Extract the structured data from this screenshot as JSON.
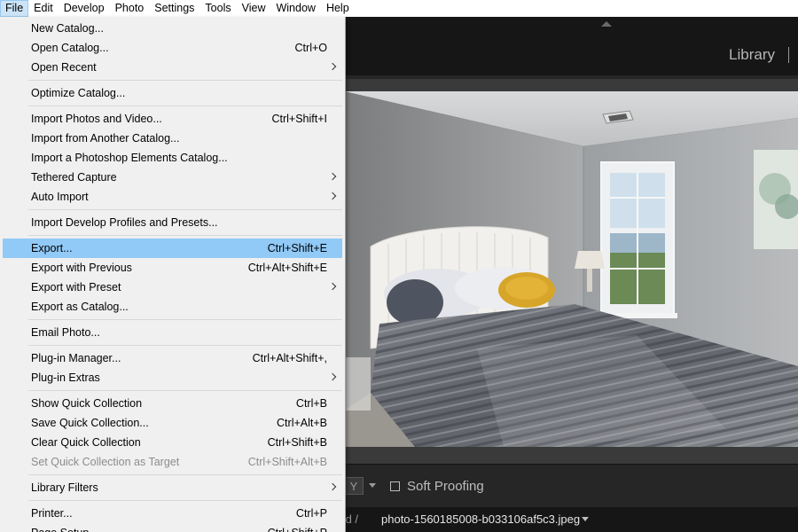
{
  "menubar": {
    "items": [
      {
        "label": "File"
      },
      {
        "label": "Edit"
      },
      {
        "label": "Develop"
      },
      {
        "label": "Photo"
      },
      {
        "label": "Settings"
      },
      {
        "label": "Tools"
      },
      {
        "label": "View"
      },
      {
        "label": "Window"
      },
      {
        "label": "Help"
      }
    ],
    "active": "File"
  },
  "module": {
    "name": "Library"
  },
  "toolbar": {
    "yy_label": "Y",
    "soft_proofing_label": "Soft Proofing"
  },
  "filmstrip": {
    "selected_text": "ected /",
    "filename": "photo-1560185008-b033106af5c3.jpeg"
  },
  "file_menu": {
    "items": [
      {
        "label": "New Catalog...",
        "shortcut": "",
        "submenu": false
      },
      {
        "label": "Open Catalog...",
        "shortcut": "Ctrl+O",
        "submenu": false
      },
      {
        "label": "Open Recent",
        "shortcut": "",
        "submenu": true
      },
      {
        "label": "Optimize Catalog...",
        "shortcut": "",
        "submenu": false
      },
      {
        "label": "Import Photos and Video...",
        "shortcut": "Ctrl+Shift+I",
        "submenu": false
      },
      {
        "label": "Import from Another Catalog...",
        "shortcut": "",
        "submenu": false
      },
      {
        "label": "Import a Photoshop Elements Catalog...",
        "shortcut": "",
        "submenu": false
      },
      {
        "label": "Tethered Capture",
        "shortcut": "",
        "submenu": true
      },
      {
        "label": "Auto Import",
        "shortcut": "",
        "submenu": true
      },
      {
        "label": "Import Develop Profiles and Presets...",
        "shortcut": "",
        "submenu": false
      },
      {
        "label": "Export...",
        "shortcut": "Ctrl+Shift+E",
        "submenu": false,
        "highlighted": true
      },
      {
        "label": "Export with Previous",
        "shortcut": "Ctrl+Alt+Shift+E",
        "submenu": false
      },
      {
        "label": "Export with Preset",
        "shortcut": "",
        "submenu": true
      },
      {
        "label": "Export as Catalog...",
        "shortcut": "",
        "submenu": false
      },
      {
        "label": "Email Photo...",
        "shortcut": "",
        "submenu": false
      },
      {
        "label": "Plug-in Manager...",
        "shortcut": "Ctrl+Alt+Shift+,",
        "submenu": false
      },
      {
        "label": "Plug-in Extras",
        "shortcut": "",
        "submenu": true
      },
      {
        "label": "Show Quick Collection",
        "shortcut": "Ctrl+B",
        "submenu": false
      },
      {
        "label": "Save Quick Collection...",
        "shortcut": "Ctrl+Alt+B",
        "submenu": false
      },
      {
        "label": "Clear Quick Collection",
        "shortcut": "Ctrl+Shift+B",
        "submenu": false
      },
      {
        "label": "Set Quick Collection as Target",
        "shortcut": "Ctrl+Shift+Alt+B",
        "submenu": false,
        "disabled": true
      },
      {
        "label": "Library Filters",
        "shortcut": "",
        "submenu": true
      },
      {
        "label": "Printer...",
        "shortcut": "Ctrl+P",
        "submenu": false
      },
      {
        "label": "Page Setup...",
        "shortcut": "Ctrl+Shift+P",
        "submenu": false
      }
    ]
  },
  "colors": {
    "highlight": "#91c9f7",
    "menu_bg": "#f0f0f0",
    "app_bg": "#1e1e1e"
  }
}
